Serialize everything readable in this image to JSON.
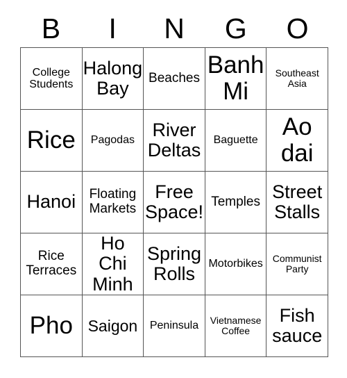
{
  "header": {
    "letters": [
      "B",
      "I",
      "N",
      "G",
      "O"
    ]
  },
  "grid": {
    "rows": 5,
    "columns": 5,
    "border_color": "#555555",
    "background_color": "#ffffff",
    "text_color": "#000000",
    "cells": [
      {
        "text": "College\nStudents",
        "size": "fs-sm"
      },
      {
        "text": "Halong\nBay",
        "size": "fs-xl"
      },
      {
        "text": "Beaches",
        "size": "fs-md"
      },
      {
        "text": "Banh\nMi",
        "size": "fs-xxl"
      },
      {
        "text": "Southeast\nAsia",
        "size": "fs-xs"
      },
      {
        "text": "Rice",
        "size": "fs-xxl"
      },
      {
        "text": "Pagodas",
        "size": "fs-sm"
      },
      {
        "text": "River\nDeltas",
        "size": "fs-xl"
      },
      {
        "text": "Baguette",
        "size": "fs-sm"
      },
      {
        "text": "Ao\ndai",
        "size": "fs-xxl"
      },
      {
        "text": "Hanoi",
        "size": "fs-xl"
      },
      {
        "text": "Floating\nMarkets",
        "size": "fs-md"
      },
      {
        "text": "Free\nSpace!",
        "size": "fs-xl"
      },
      {
        "text": "Temples",
        "size": "fs-md"
      },
      {
        "text": "Street\nStalls",
        "size": "fs-xl"
      },
      {
        "text": "Rice\nTerraces",
        "size": "fs-md"
      },
      {
        "text": "Ho Chi\nMinh",
        "size": "fs-xl"
      },
      {
        "text": "Spring\nRolls",
        "size": "fs-xl"
      },
      {
        "text": "Motorbikes",
        "size": "fs-sm"
      },
      {
        "text": "Communist\nParty",
        "size": "fs-xs"
      },
      {
        "text": "Pho",
        "size": "fs-xxl"
      },
      {
        "text": "Saigon",
        "size": "fs-lg"
      },
      {
        "text": "Peninsula",
        "size": "fs-sm"
      },
      {
        "text": "Vietnamese\nCoffee",
        "size": "fs-xs"
      },
      {
        "text": "Fish\nsauce",
        "size": "fs-xl"
      }
    ]
  }
}
